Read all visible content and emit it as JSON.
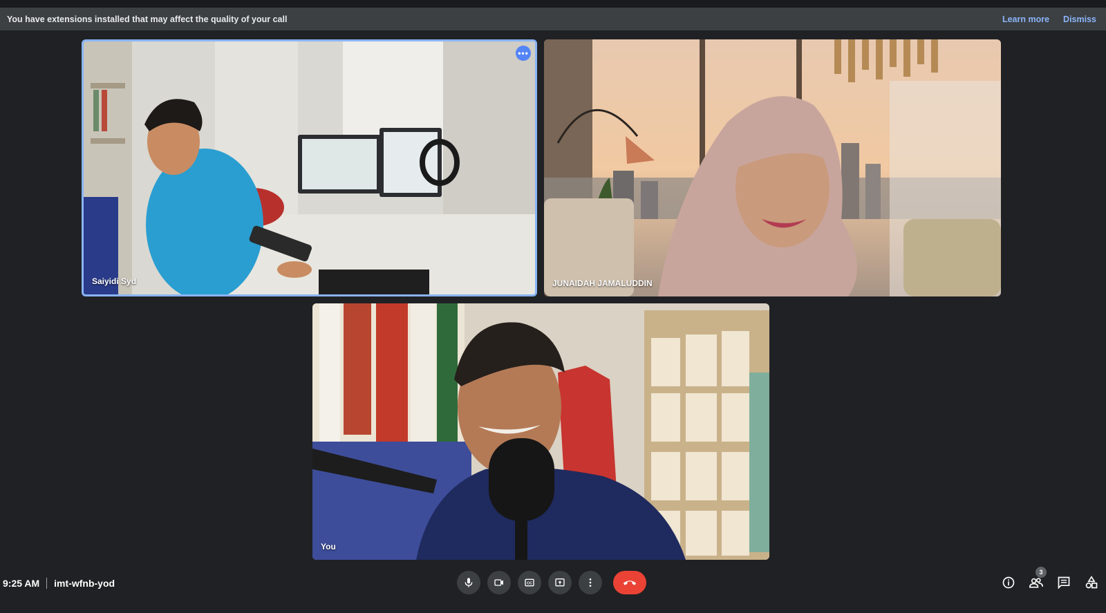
{
  "banner": {
    "message": "You have extensions installed that may affect the quality of your call",
    "learn_more": "Learn more",
    "dismiss": "Dismiss"
  },
  "participants": [
    {
      "name": "Saiyidi Syd",
      "speaking": true
    },
    {
      "name": "JUNAIDAH JAMALUDDIN",
      "speaking": false
    },
    {
      "name": "You",
      "speaking": false
    }
  ],
  "meeting": {
    "time": "9:25 AM",
    "code": "imt-wfnb-yod"
  },
  "controls": [
    "microphone-icon",
    "camera-icon",
    "captions-icon",
    "present-icon",
    "more-options-icon",
    "end-call-icon"
  ],
  "right_panel": {
    "people_count": "3",
    "icons": [
      "info-icon",
      "people-icon",
      "chat-icon",
      "activities-icon"
    ]
  },
  "colors": {
    "background": "#202124",
    "banner": "#3c4043",
    "link": "#8ab4f8",
    "active_border": "#8ab4f8",
    "end_call": "#ea4335"
  }
}
